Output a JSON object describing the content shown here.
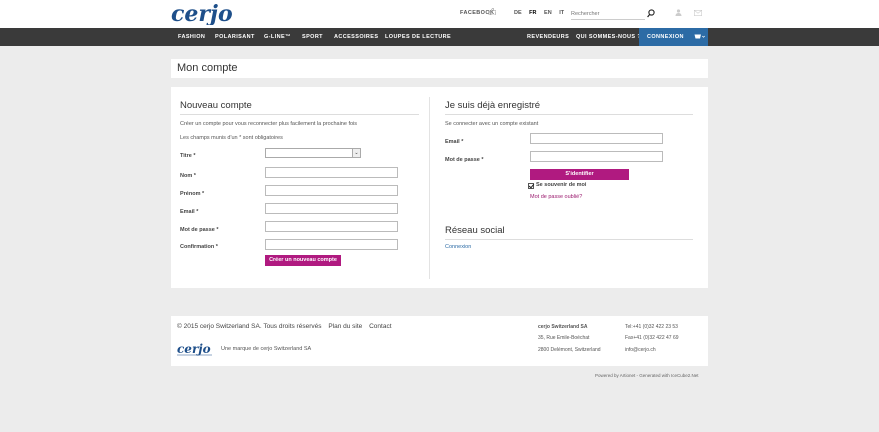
{
  "header": {
    "logo_text": "cerjo",
    "facebook": "FACEBOOK",
    "languages": [
      "DE",
      "FR",
      "EN",
      "IT"
    ],
    "active_language": "FR",
    "search_placeholder": "Rechercher"
  },
  "nav": {
    "items": [
      "FASHION",
      "POLARISANT",
      "G-LINE™",
      "SPORT",
      "ACCESSOIRES",
      "LOUPES DE LECTURE"
    ],
    "right_items": [
      "REVENDEURS",
      "QUI SOMMES-NOUS ?"
    ],
    "connexion": "CONNEXION"
  },
  "page_title": "Mon compte",
  "register": {
    "title": "Nouveau compte",
    "intro": "Créer un compte pour vous reconnecter plus facilement la prochaine fois",
    "required_note": "Les champs munis d'un * sont obligatoires",
    "labels": {
      "titre": "Titre *",
      "nom": "Nom *",
      "prenom": "Prénom *",
      "email": "Email *",
      "password": "Mot de passe *",
      "confirm": "Confirmation *"
    },
    "submit": "Créer un nouveau compte"
  },
  "login": {
    "title": "Je suis déjà enregistré",
    "intro": "Se connecter avec un compte existant",
    "labels": {
      "email": "Email *",
      "password": "Mot de passe *"
    },
    "submit": "S'identifier",
    "remember": "Se souvenir de moi",
    "forgot": "Mot de passe oublié?"
  },
  "social": {
    "title": "Réseau social",
    "connexion": "Connexion"
  },
  "footer": {
    "copyright": "© 2015 cerjo Switzerland SA. Tous droits réservés",
    "sitemap": "Plan du site",
    "contact": "Contact",
    "brand_line": "Une marque de cerjo Switzerland SA",
    "company": "cerjo Switzerland SA",
    "street": "35, Rue Emile-Boéchat",
    "city": "2800 Delémont, Switzerland",
    "tel": "Tel:+41 (0)32 422 23 53",
    "fax": "Fax+41 (0)32 422 47 69",
    "email": "info@cerjo.ch",
    "powered": "Powered by Artionet - Generated with IceCube2.Net"
  },
  "colors": {
    "nav_bg": "#3a3a3a",
    "accent_blue": "#2c6ba5",
    "accent_magenta": "#b01a80"
  }
}
